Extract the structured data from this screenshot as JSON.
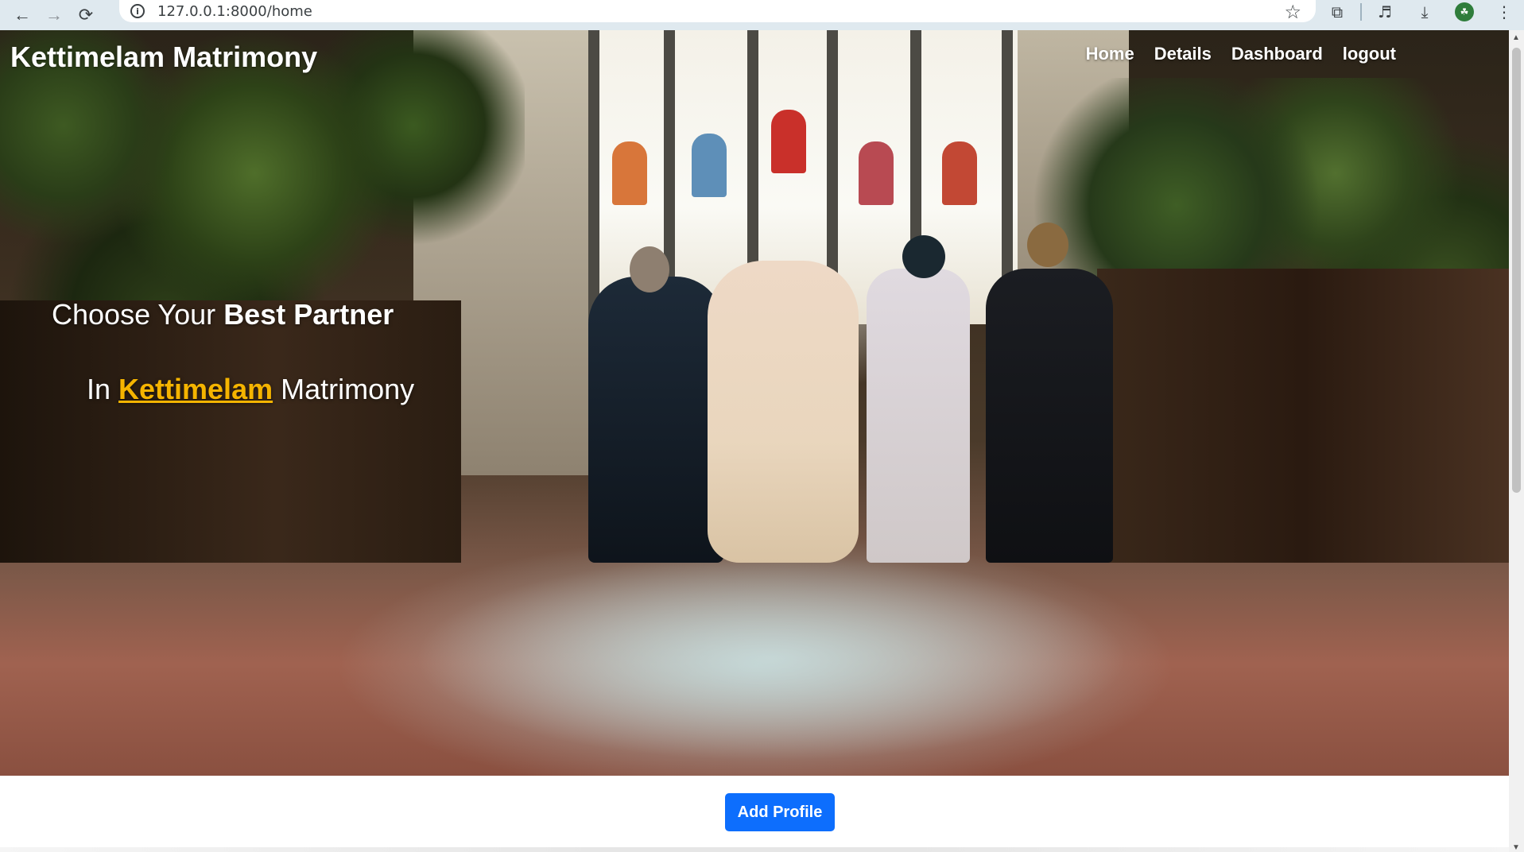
{
  "browser": {
    "back_icon": "←",
    "forward_icon": "→",
    "reload_icon": "⟳",
    "info_icon": "i",
    "url": "127.0.0.1:8000/home",
    "star_icon": "☆",
    "extensions_icon": "⧉",
    "media_icon": "♬",
    "download_icon": "⤓",
    "profile_icon": "☘",
    "menu_icon": "⋮"
  },
  "site": {
    "brand": "Kettimelam Matrimony",
    "nav": [
      {
        "label": "Home"
      },
      {
        "label": "Details"
      },
      {
        "label": "Dashboard"
      },
      {
        "label": "logout"
      }
    ]
  },
  "hero": {
    "line1_prefix": "Choose Your ",
    "line1_bold": "Best Partner",
    "line2_prefix": "In ",
    "line2_highlight": "Kettimelam",
    "line2_suffix": " Matrimony"
  },
  "actions": {
    "add_profile": "Add Profile"
  },
  "colors": {
    "accent": "#0d6efd",
    "highlight": "#f5b400"
  }
}
